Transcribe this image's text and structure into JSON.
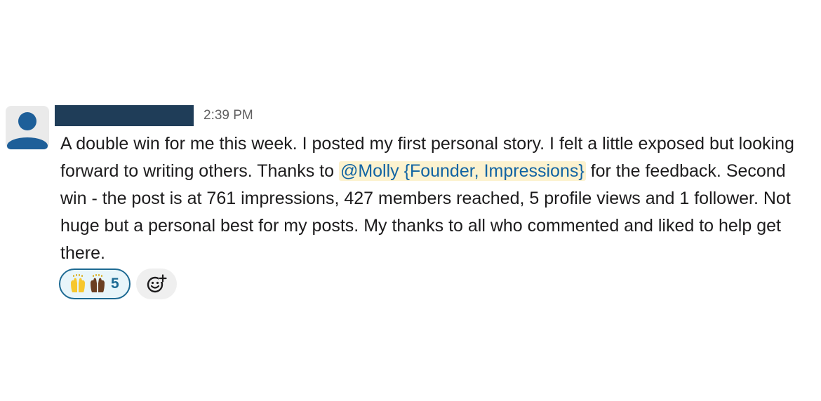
{
  "message": {
    "author_redacted": true,
    "timestamp": "2:39 PM",
    "text_part1": "A double win for me this week. I posted my first personal story.  I felt a little exposed but looking forward to writing others.  Thanks to ",
    "mention": "@Molly {Founder, Impressions}",
    "text_part2": " for the feedback.  Second win - the post is at 761 impressions, 427 members reached, 5 profile views and 1 follower.  Not huge but a personal best for my posts.  My thanks to all who commented and liked to help get there."
  },
  "reactions": [
    {
      "icons": [
        "raised-hands-icon-light",
        "raised-hands-icon-dark"
      ],
      "count": "5",
      "reacted_by_me": true
    }
  ],
  "add_reaction_icon": "add-reaction-icon",
  "colors": {
    "redaction": "#1f3d58",
    "mention_bg": "#fcf2cf",
    "mention_text": "#1264a3",
    "reaction_border": "#1d6a93",
    "avatar_figure": "#1e5f99"
  }
}
